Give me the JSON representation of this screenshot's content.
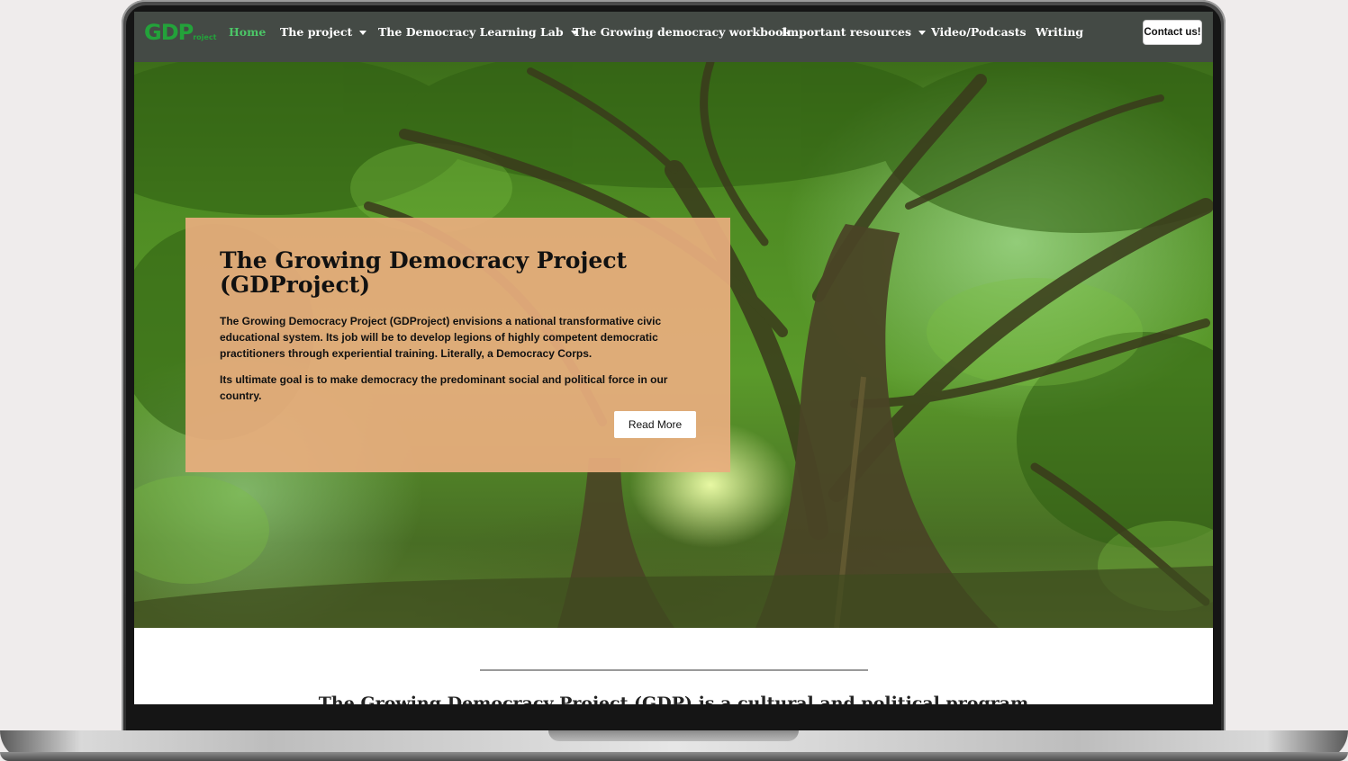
{
  "logo": {
    "text": "GDP",
    "sub": "roject"
  },
  "nav": {
    "items": [
      {
        "label": "Home",
        "active": true,
        "dropdown": false
      },
      {
        "label": "The project",
        "dropdown": true
      },
      {
        "label": "The Democracy Learning Lab",
        "dropdown": true
      },
      {
        "label": "The Growing democracy workbook",
        "dropdown": false
      },
      {
        "label": "Important resources",
        "dropdown": true
      },
      {
        "label": "Video/Podcasts",
        "dropdown": false
      },
      {
        "label": "Writing",
        "dropdown": false
      }
    ],
    "contact_label": "Contact us!"
  },
  "hero": {
    "title": "The Growing Democracy Project (GDProject)",
    "paragraph1": "The Growing Democracy Project (GDProject) envisions a national transformative civic educational system. Its job will be to develop legions of highly competent democratic practitioners through experiential training. Literally, a Democracy Corps.",
    "paragraph2": "Its ultimate goal is to make democracy the predominant social and political force in our country.",
    "read_more_label": "Read More"
  },
  "section": {
    "heading": "The Growing Democracy Project (GDP) is a cultural and political program"
  },
  "colors": {
    "navbar": "#444a45",
    "nav_active": "#4cc567",
    "logo": "#23a23a",
    "hero_card": "#e8ad7e"
  }
}
